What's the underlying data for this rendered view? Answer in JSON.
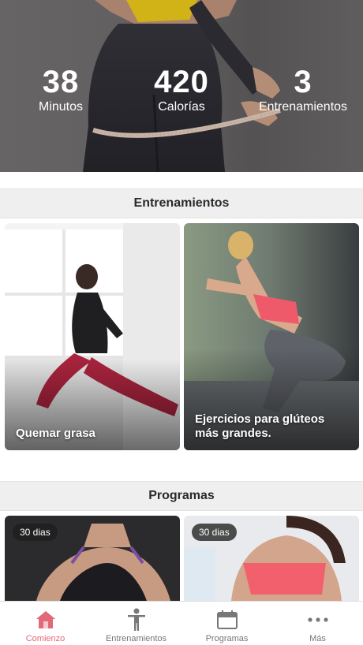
{
  "stats": [
    {
      "value": "38",
      "label": "Minutos"
    },
    {
      "value": "420",
      "label": "Calorías"
    },
    {
      "value": "3",
      "label": "Entrenamientos"
    }
  ],
  "sections": {
    "workouts_title": "Entrenamientos",
    "programs_title": "Programas"
  },
  "workouts": [
    {
      "title": "Quemar grasa"
    },
    {
      "title": "Ejercicios para glúteos más grandes."
    }
  ],
  "programs": [
    {
      "badge": "30 dias"
    },
    {
      "badge": "30 dias"
    }
  ],
  "tabs": [
    {
      "label": "Comienzo",
      "icon": "home-icon",
      "active": true
    },
    {
      "label": "Entrenamientos",
      "icon": "person-icon",
      "active": false
    },
    {
      "label": "Programas",
      "icon": "calendar-icon",
      "active": false
    },
    {
      "label": "Más",
      "icon": "more-icon",
      "active": false
    }
  ],
  "colors": {
    "accent": "#e06a78",
    "inactive": "#777777"
  }
}
